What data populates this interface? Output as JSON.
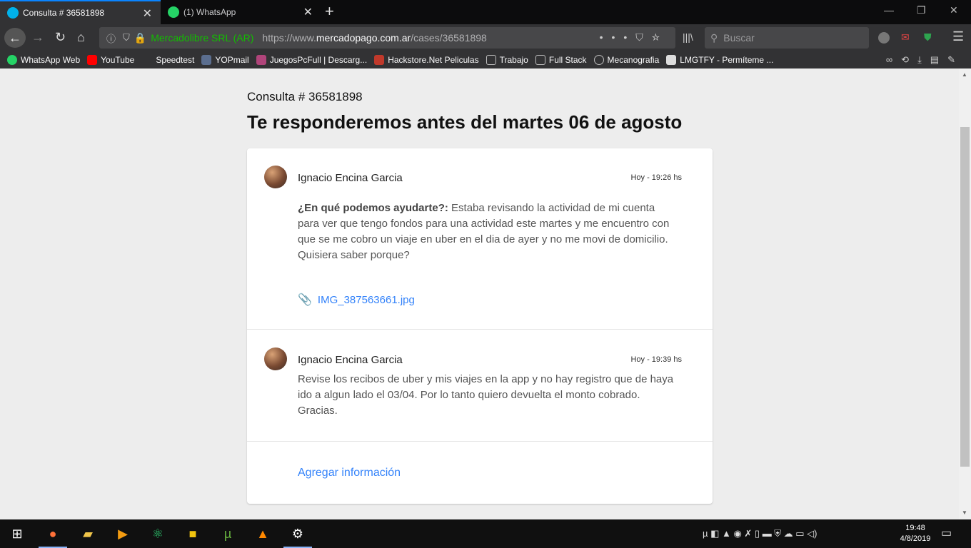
{
  "browser": {
    "tabs": [
      {
        "title": "Consulta # 36581898",
        "icon": "mercadopago-icon",
        "active": true
      },
      {
        "title": "(1) WhatsApp",
        "icon": "whatsapp-icon",
        "active": false
      }
    ],
    "new_tab": "+",
    "window_controls": {
      "minimize": "—",
      "restore": "❐",
      "close": "✕"
    },
    "site_identity": "Mercadolibre SRL (AR)",
    "url_prefix": "https://www.",
    "url_domain": "mercadopago.com.ar",
    "url_path": "/cases/36581898",
    "search_placeholder": "Buscar",
    "bookmarks": [
      {
        "label": "WhatsApp Web",
        "color": "#25d366"
      },
      {
        "label": "YouTube",
        "color": "#ff0000"
      },
      {
        "label": "Speedtest",
        "color": "#202020"
      },
      {
        "label": "YOPmail",
        "color": "#5b6e8f"
      },
      {
        "label": "JuegosPcFull | Descarg...",
        "color": "#b0447a"
      },
      {
        "label": "Hackstore.Net Peliculas",
        "color": "#c0392b"
      },
      {
        "label": "Trabajo",
        "color": "#9a9a9a"
      },
      {
        "label": "Full Stack",
        "color": "#9a9a9a"
      },
      {
        "label": "Mecanografia",
        "color": "#bbbbbb"
      },
      {
        "label": "LMGTFY - Permíteme ...",
        "color": "#dddddd"
      }
    ]
  },
  "page": {
    "case_id": "Consulta # 36581898",
    "title": "Te responderemos antes del martes 06 de agosto",
    "messages": [
      {
        "author": "Ignacio Encina Garcia",
        "time": "Hoy - 19:26 hs",
        "question_label": "¿En qué podemos ayudarte?:",
        "text": " Estaba revisando la actividad de mi cuenta para ver que tengo fondos para una actividad este martes y me encuentro con que se me cobro un viaje en uber en el dia de ayer y no me movi de domicilio. Quisiera saber porque?",
        "attachment": "IMG_387563661.jpg"
      },
      {
        "author": "Ignacio Encina Garcia",
        "time": "Hoy - 19:39 hs",
        "text": "Revise los recibos de uber y mis viajes en la app y no hay registro que de haya ido a algun lado el 03/04. Por lo tanto quiero devuelta el monto cobrado. Gracias."
      }
    ],
    "add_info": "Agregar información"
  },
  "taskbar": {
    "time": "19:48",
    "date": "4/8/2019"
  },
  "colors": {
    "accent": "#3483fa",
    "secure": "#12bc00",
    "tab_highlight": "#0a84ff"
  }
}
